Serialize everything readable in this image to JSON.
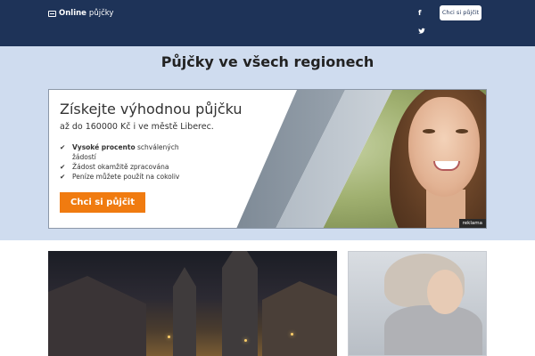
{
  "header": {
    "brand_bold": "Online",
    "brand_rest": "půjčky",
    "cta_label": "Chci si půjčit",
    "facebook_glyph": "f"
  },
  "region": {
    "title": "Půjčky ve všech regionech"
  },
  "banner": {
    "headline": "Získejte výhodnou půjčku",
    "subline": "až do 160000 Kč i ve městě Liberec.",
    "benefits": [
      {
        "bold": "Vysoké procento",
        "rest": " schválených",
        "rest2": "žádostí"
      },
      {
        "text": "Žádost okamžitě zpracována"
      },
      {
        "text": "Peníze můžete použít na cokoliv"
      }
    ],
    "cta_label": "Chci si půjčit",
    "ad_label": "reklama"
  },
  "colors": {
    "header_bg": "#1e3358",
    "band_bg": "#cfdcef",
    "cta_orange": "#f07b10"
  },
  "icons": {
    "brand": "money-icon",
    "facebook": "facebook-icon",
    "twitter": "twitter-icon",
    "check": "check-icon"
  }
}
